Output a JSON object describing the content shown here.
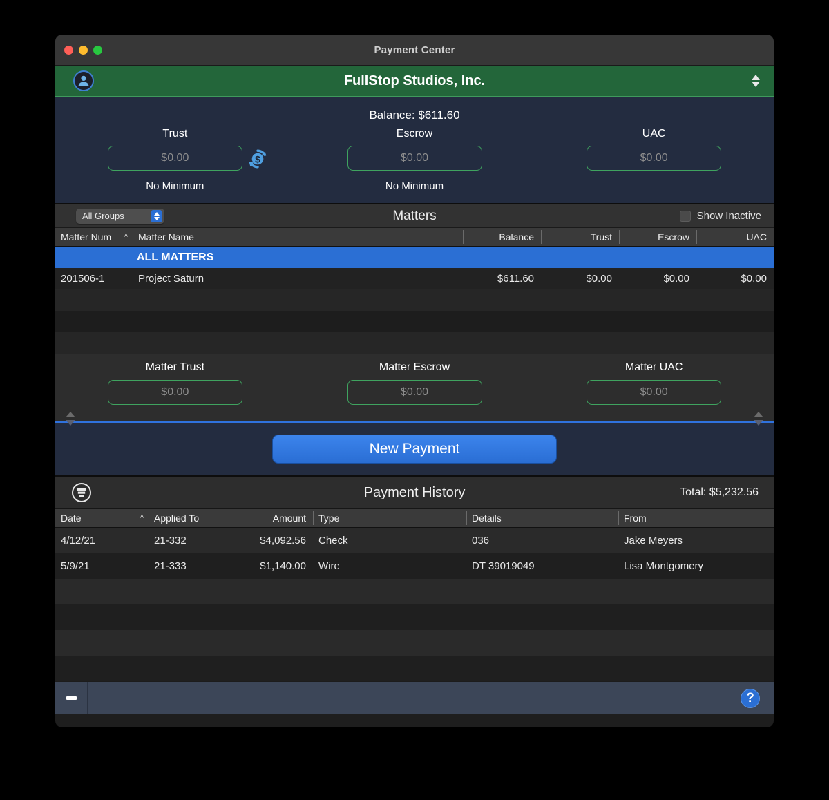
{
  "window": {
    "title": "Payment Center",
    "traffic_lights": [
      "close",
      "minimize",
      "zoom"
    ]
  },
  "client_bar": {
    "avatar_icon": "user-avatar-icon",
    "client_name": "FullStop Studios, Inc.",
    "stepper_icon": "up-down-stepper-icon"
  },
  "balances": {
    "balance_line": "Balance: $611.60",
    "transfer_icon": "dollar-refresh-icon",
    "columns": [
      {
        "label": "Trust",
        "value": "$0.00",
        "placeholder": "$0.00",
        "sub": "No Minimum"
      },
      {
        "label": "Escrow",
        "value": "$0.00",
        "placeholder": "$0.00",
        "sub": "No Minimum"
      },
      {
        "label": "UAC",
        "value": "$0.00",
        "placeholder": "$0.00",
        "sub": ""
      }
    ]
  },
  "matters": {
    "group_filter": {
      "value": "All Groups",
      "icon": "chevron-updown-icon"
    },
    "title": "Matters",
    "show_inactive": {
      "label": "Show Inactive",
      "checked": false
    },
    "columns": [
      {
        "key": "number",
        "label": "Matter Num",
        "sort": "^"
      },
      {
        "key": "name",
        "label": "Matter Name"
      },
      {
        "key": "balance",
        "label": "Balance"
      },
      {
        "key": "trust",
        "label": "Trust"
      },
      {
        "key": "escrow",
        "label": "Escrow"
      },
      {
        "key": "uac",
        "label": "UAC"
      }
    ],
    "group_row_label": "ALL MATTERS",
    "rows": [
      {
        "number": "201506-1",
        "name": "Project Saturn",
        "balance": "$611.60",
        "trust": "$0.00",
        "escrow": "$0.00",
        "uac": "$0.00"
      }
    ]
  },
  "matter_balances": {
    "columns": [
      {
        "label": "Matter Trust",
        "value": "$0.00",
        "placeholder": "$0.00"
      },
      {
        "label": "Matter Escrow",
        "value": "$0.00",
        "placeholder": "$0.00"
      },
      {
        "label": "Matter UAC",
        "value": "$0.00",
        "placeholder": "$0.00"
      }
    ]
  },
  "actions": {
    "new_payment_label": "New Payment"
  },
  "payment_history": {
    "filter_icon": "filter-lines-icon",
    "title": "Payment History",
    "total": "Total: $5,232.56",
    "columns": [
      {
        "key": "date",
        "label": "Date",
        "sort": "^"
      },
      {
        "key": "applied_to",
        "label": "Applied To"
      },
      {
        "key": "amount",
        "label": "Amount"
      },
      {
        "key": "type",
        "label": "Type"
      },
      {
        "key": "details",
        "label": "Details"
      },
      {
        "key": "from",
        "label": "From"
      }
    ],
    "rows": [
      {
        "date": "4/12/21",
        "applied_to": "21-332",
        "amount": "$4,092.56",
        "type": "Check",
        "details": "036",
        "from": "Jake Meyers"
      },
      {
        "date": "5/9/21",
        "applied_to": "21-333",
        "amount": "$1,140.00",
        "type": "Wire",
        "details": "DT 39019049",
        "from": "Lisa Montgomery"
      }
    ]
  },
  "footer": {
    "remove_icon": "minus-icon",
    "help_icon": "help-question-icon",
    "help_label": "?"
  },
  "colors": {
    "accent_blue": "#2b6fd4",
    "client_green": "#23663a",
    "field_green": "#3fa35f",
    "panel_navy": "#232c40"
  }
}
